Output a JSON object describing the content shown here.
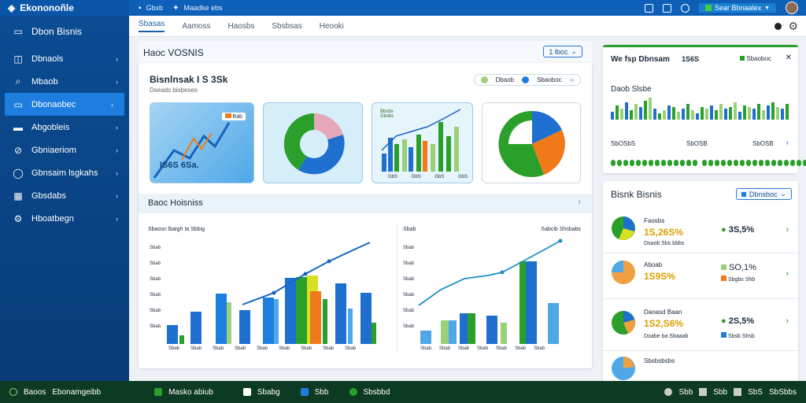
{
  "app": {
    "title": "Ekononoñle"
  },
  "topbar": {
    "items": [
      "Gbxb",
      "Maadke ebs"
    ],
    "account": "Sear Bbnaalex"
  },
  "sidebar": {
    "header": "Dbon Bisnis",
    "items": [
      {
        "label": "Dbnaols",
        "icon": "bag-icon"
      },
      {
        "label": "Mbaob",
        "icon": "search-icon"
      },
      {
        "label": "Dbonaobec",
        "icon": "wallet-icon",
        "active": true
      },
      {
        "label": "Abgobleis",
        "icon": "card-icon"
      },
      {
        "label": "Gbniaeriom",
        "icon": "link-icon"
      },
      {
        "label": "Gbnsaim lsgkahs",
        "icon": "globe-icon"
      },
      {
        "label": "Gbsdabs",
        "icon": "calendar-icon"
      },
      {
        "label": "Hboatbegn",
        "icon": "gear-icon"
      }
    ]
  },
  "subnav": {
    "tabs": [
      "Sbasas",
      "Aamoss",
      "Haosbs",
      "Sbsbsas",
      "Heooki"
    ]
  },
  "overview": {
    "title": "Haoc VOSNIS",
    "select": "1 lboc",
    "panel_title": "Bisnlnsak I S 3Sk",
    "panel_subtitle": "Dseads bisbeses",
    "legend": [
      {
        "label": "Dbaob",
        "color": "#9ad07a"
      },
      {
        "label": "Sbaoboc",
        "color": "#1e7ee0"
      }
    ],
    "tile_badge": "Bab",
    "tile_value": "IS6S 6Sa.",
    "tile3_title": "Bbsbs\nGbsbc",
    "tile3_labels": [
      "GbS",
      "GbS",
      "GbS",
      "GbS"
    ],
    "section_title": "Baoc Hoisniss"
  },
  "chart_left": {
    "title": "Sbaosn lbaigh Ia Sbbig",
    "ylabels": [
      "Sbab",
      "Sbab",
      "Sbab",
      "Sbab",
      "Sbab",
      "Sbab"
    ],
    "xlabels": [
      "Sbab",
      "Sbab",
      "Sbab",
      "Sbab",
      "Sbab",
      "Sbab",
      "Sbab",
      "Sbab",
      "Sbab"
    ]
  },
  "chart_right": {
    "title": "Sbab",
    "title_right": "Sabcib Shsbabs",
    "ylabels": [
      "Sbab",
      "Sbab",
      "Sbab",
      "Sbab",
      "Sbab",
      "Sbab"
    ],
    "xlabels": [
      "Sbab",
      "Sbab",
      "Sbab",
      "Sbab",
      "Sbab",
      "Sbab",
      "Sbab"
    ]
  },
  "right_top": {
    "title": "We fsp Dbnsam",
    "count": "1S6S",
    "tag": "Sbaoboc",
    "sub": "Daob Slsbe",
    "values": [
      "SbOSbS",
      "SbOSB",
      "SbOSB"
    ]
  },
  "right_list": {
    "title": "Bisnk Bisnis",
    "button": "Dbnsboc",
    "items": [
      {
        "name": "Faosbs",
        "value": "1S,26S%",
        "sub": "Dsaob Sbs bbbs",
        "change": "3S,5%",
        "marker": "#2aa02a"
      },
      {
        "name": "Aboab",
        "value": "1S9S%",
        "sub": "",
        "change": "SO,1%",
        "change2": "Sbgbs Shb",
        "marker": "#9ad07a"
      },
      {
        "name": "Daoasd Baan",
        "value": "1S2,S6%",
        "sub": "Doabe ba Sbaaab",
        "change": "2S,5%",
        "change2": "Sbsb Shsb",
        "marker": "#2aa02a"
      },
      {
        "name": "Sbsbsbsbs",
        "value": "",
        "sub": "",
        "change": ""
      }
    ]
  },
  "bottombar": {
    "left": [
      "Baoos",
      "Ebonamgeibb"
    ],
    "items": [
      "Masko abiub",
      "Sbabg",
      "Sbb",
      "Sbsbbd"
    ],
    "right": [
      "Sbb",
      "Sbb",
      "SbS",
      "SbSbbs"
    ]
  },
  "colors": {
    "blue": "#1e7ee0",
    "green": "#2aa02a",
    "orange": "#f07a1a",
    "yellow": "#d8e024"
  }
}
